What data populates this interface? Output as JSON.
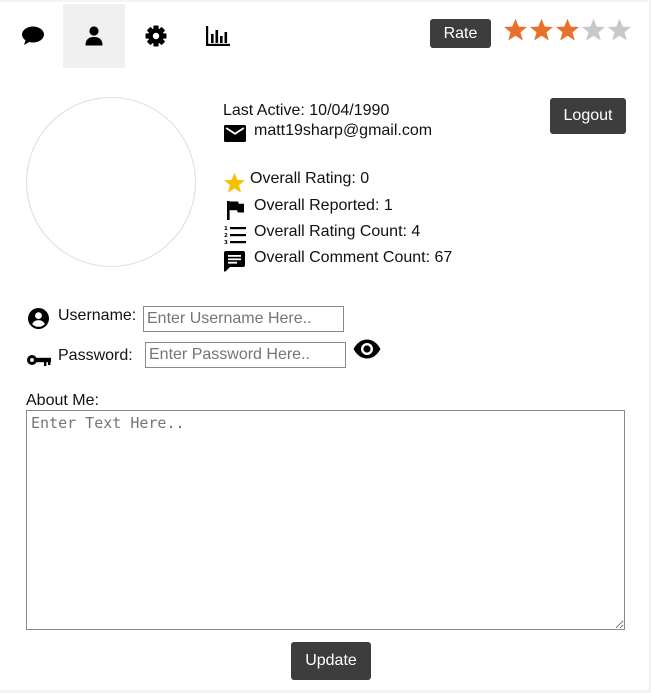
{
  "nav": {
    "tabs": [
      {
        "name": "chat-icon",
        "active": false
      },
      {
        "name": "user-icon",
        "active": true
      },
      {
        "name": "gear-icon",
        "active": false
      },
      {
        "name": "bar-chart-icon",
        "active": false
      }
    ]
  },
  "rating": {
    "button_label": "Rate",
    "stars_filled": 3,
    "stars_total": 5,
    "filled_color": "#e8702a",
    "empty_color": "#c8c8c8"
  },
  "profile": {
    "last_active_label": "Last Active: 10/04/1990",
    "email": "matt19sharp@gmail.com",
    "logout_label": "Logout",
    "stats": {
      "overall_rating": "Overall Rating: 0",
      "overall_reported": "Overall Reported: 1",
      "overall_rating_count": "Overall Rating Count: 4",
      "overall_comment_count": "Overall Comment Count: 67"
    },
    "star_icon_color": "#f5c000"
  },
  "form": {
    "username_label": "Username:",
    "username_placeholder": "Enter Username Here..",
    "password_label": "Password:",
    "password_placeholder": "Enter Password Here..",
    "about_label": "About Me:",
    "about_placeholder": "Enter Text Here..",
    "update_label": "Update"
  }
}
